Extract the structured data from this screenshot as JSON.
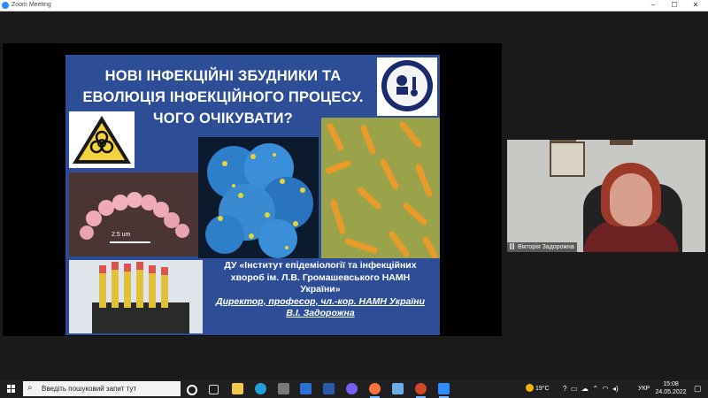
{
  "window": {
    "title": "Zoom Meeting",
    "controls": [
      "–",
      "☐",
      "✕"
    ]
  },
  "slide": {
    "title_lines": [
      "НОВІ  ІНФЕКЦІЙНІ ЗБУДНИКИ ТА",
      "ЕВОЛЮЦІЯ ІНФЕКЦІЙНОГО ПРОЦЕСУ.",
      "ЧОГО ОЧІКУВАТИ?"
    ],
    "scale_bar": "2.5 um",
    "institute_lines": [
      "ДУ «Інститут епідеміології та інфекційних",
      "хвороб ім. Л.В. Громашевського НАМН",
      "України»"
    ],
    "director_lines": [
      "Директор, професор, чл.-кор. НАМН України",
      "В.І. Задорожна"
    ],
    "icons": [
      "institute-logo-icon",
      "biohazard-icon"
    ]
  },
  "participant": {
    "name": "Вікторія Задорожна",
    "icon": "signal-icon"
  },
  "taskbar": {
    "search_placeholder": "Введіть пошуковий запит тут",
    "apps": [
      "task-view-icon",
      "file-explorer-icon",
      "edge-icon",
      "store-icon",
      "mail-icon",
      "word-icon",
      "viber-icon",
      "firefox-icon",
      "paint-icon",
      "powerpoint-icon",
      "zoom-icon"
    ],
    "weather": "19°C",
    "language": "УКР",
    "time": "15:08",
    "date": "24.05.2022"
  }
}
